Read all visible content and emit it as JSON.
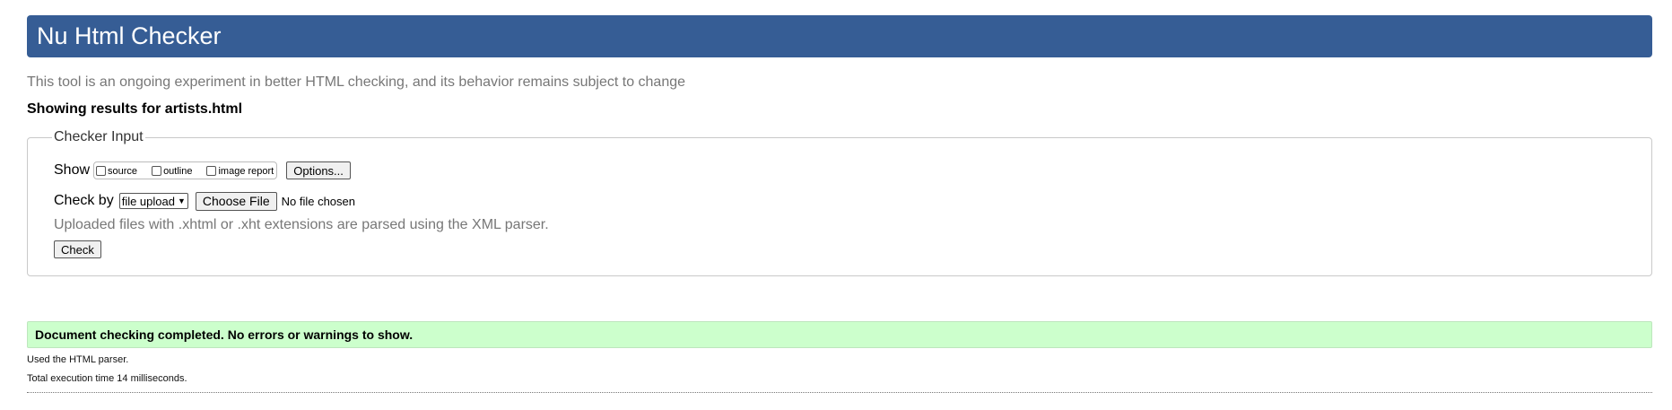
{
  "header": {
    "title": "Nu Html Checker"
  },
  "tagline": "This tool is an ongoing experiment in better HTML checking, and its behavior remains subject to change",
  "showing_results": "Showing results for artists.html",
  "checker_input": {
    "legend": "Checker Input",
    "show_label": "Show",
    "show_options": [
      {
        "label": "source",
        "checked": false
      },
      {
        "label": "outline",
        "checked": false
      },
      {
        "label": "image report",
        "checked": false
      }
    ],
    "options_button": "Options...",
    "check_by_label": "Check by",
    "check_by_selected": "file upload",
    "choose_file_button": "Choose File",
    "no_file_text": "No file chosen",
    "note": "Uploaded files with .xhtml or .xht extensions are parsed using the XML parser.",
    "check_button": "Check"
  },
  "result": {
    "message": "Document checking completed. No errors or warnings to show.",
    "parser_info": "Used the HTML parser.",
    "execution_time": "Total execution time 14 milliseconds."
  }
}
